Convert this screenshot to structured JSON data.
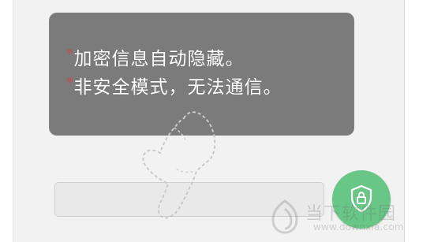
{
  "screen": {
    "tooltip": {
      "lines": [
        {
          "bullet": "*",
          "text": "加密信息自动隐藏。"
        },
        {
          "bullet": "*",
          "text": "非安全模式，无法通信。"
        }
      ]
    },
    "input": {
      "value": "",
      "placeholder": ""
    },
    "lock_button": {
      "icon": "lock-shield-icon",
      "color": "#68c786"
    },
    "watermark": {
      "title": "当下软件园",
      "url": "www.downxia.com"
    }
  }
}
